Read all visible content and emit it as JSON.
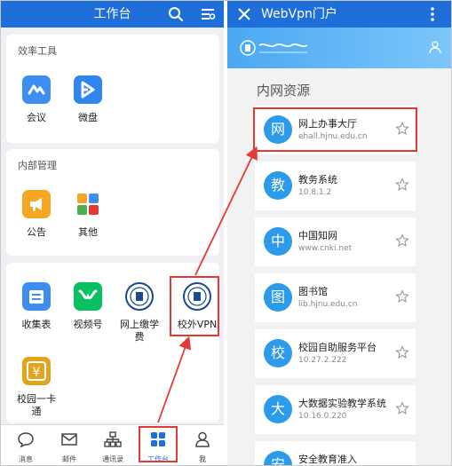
{
  "left": {
    "header": {
      "title": "工作台"
    },
    "sections": [
      {
        "title": "效率工具",
        "apps": [
          {
            "label": "会议"
          },
          {
            "label": "微盘"
          }
        ]
      },
      {
        "title": "内部管理",
        "apps": [
          {
            "label": "公告"
          },
          {
            "label": "其他"
          }
        ]
      },
      {
        "title": "",
        "apps": [
          {
            "label": "收集表"
          },
          {
            "label": "视频号"
          },
          {
            "label": "网上缴学",
            "label2": "费"
          },
          {
            "label": "校外VPN"
          },
          {
            "label": "校园一卡",
            "label2": "通"
          }
        ]
      }
    ],
    "tabbar": [
      {
        "label": "消息",
        "icon": "chat-icon"
      },
      {
        "label": "邮件",
        "icon": "mail-icon"
      },
      {
        "label": "通讯录",
        "icon": "contacts-icon"
      },
      {
        "label": "工作台",
        "icon": "grid-icon"
      },
      {
        "label": "我",
        "icon": "person-icon"
      }
    ],
    "colors": {
      "header": "#1e6fd9",
      "active_tab": "#1e6fd9",
      "highlight": "#e53935"
    }
  },
  "right": {
    "header": {
      "title": "WebVpn门户"
    },
    "section_title": "内网资源",
    "resources": [
      {
        "avatar": "网",
        "name": "网上办事大厅",
        "url": "ehall.hjnu.edu.cn"
      },
      {
        "avatar": "教",
        "name": "教务系统",
        "url": "10.8.1.2"
      },
      {
        "avatar": "中",
        "name": "中国知网",
        "url": "www.cnki.net"
      },
      {
        "avatar": "图",
        "name": "图书馆",
        "url": "lib.hjnu.edu.cn"
      },
      {
        "avatar": "校",
        "name": "校园自助服务平台",
        "url": "10.27.2.222"
      },
      {
        "avatar": "大",
        "name": "大数据实验教学系统",
        "url": "10.16.0.220"
      },
      {
        "avatar": "安",
        "name": "安全教育准入",
        "url": ""
      }
    ]
  }
}
